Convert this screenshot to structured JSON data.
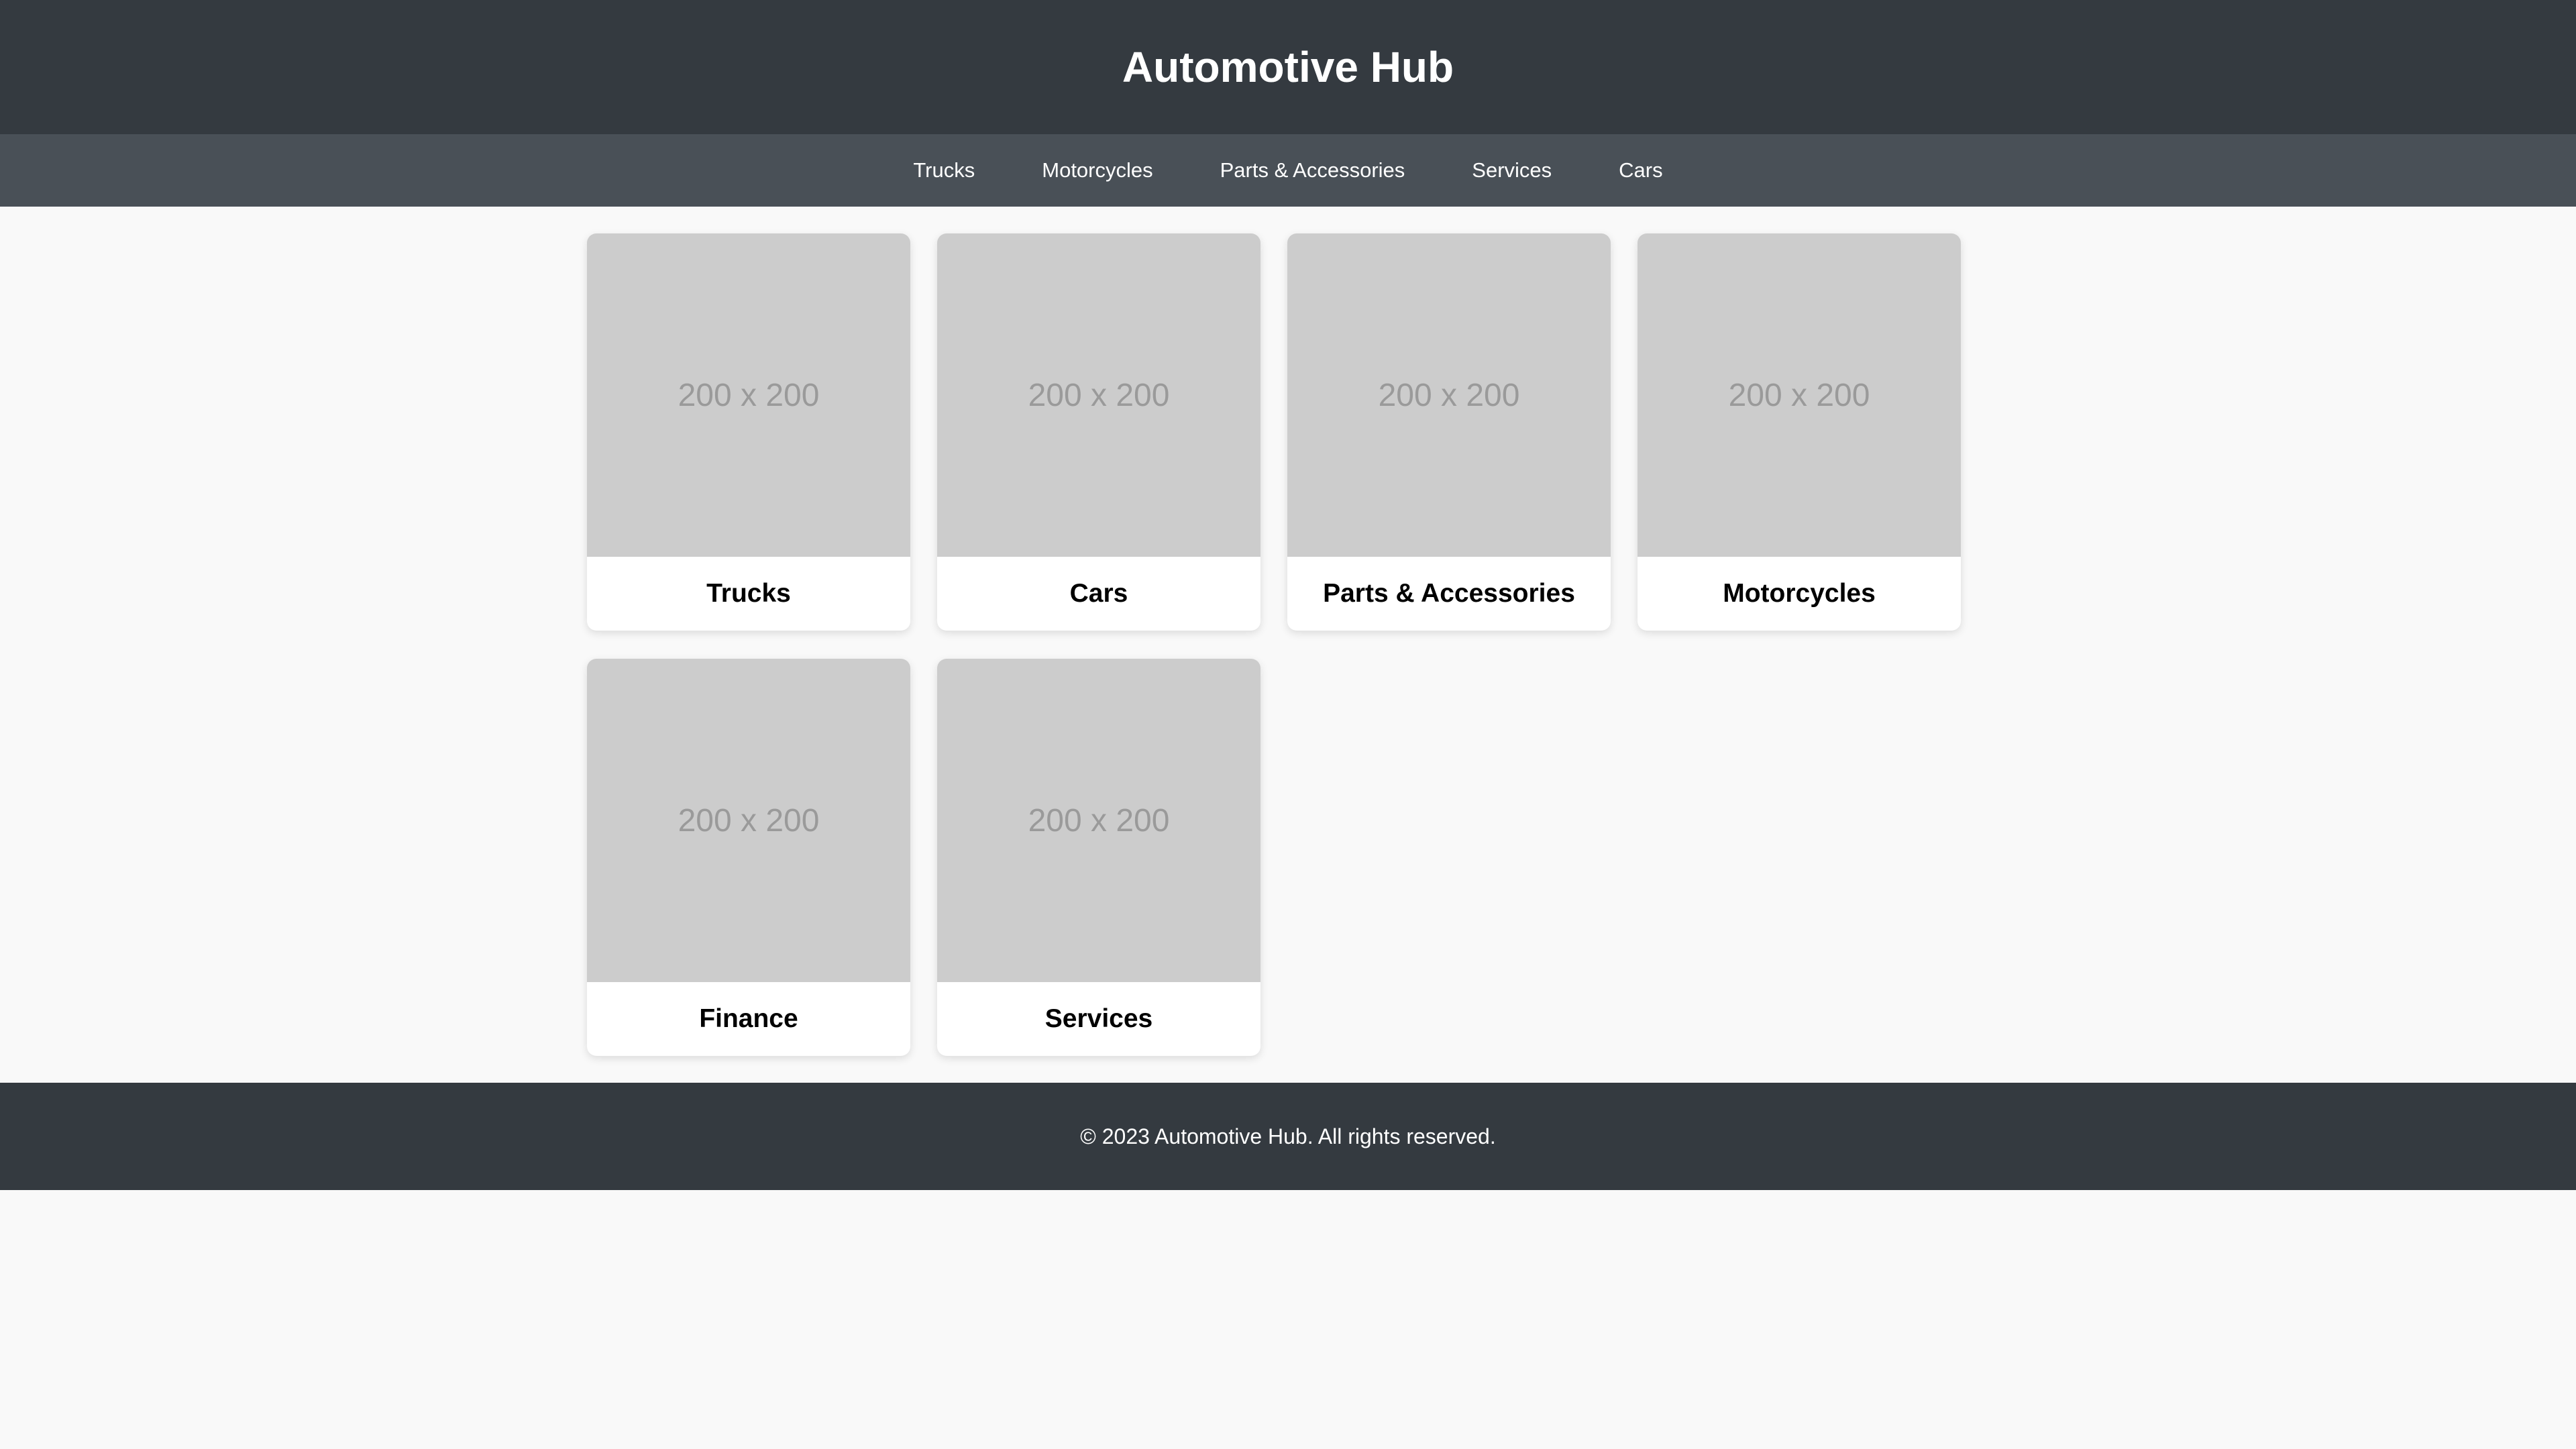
{
  "header": {
    "title": "Automotive Hub"
  },
  "nav": {
    "items": [
      {
        "label": "Trucks"
      },
      {
        "label": "Motorcycles"
      },
      {
        "label": "Parts & Accessories"
      },
      {
        "label": "Services"
      },
      {
        "label": "Cars"
      }
    ]
  },
  "cards": [
    {
      "image_label": "200 x 200",
      "title": "Trucks"
    },
    {
      "image_label": "200 x 200",
      "title": "Cars"
    },
    {
      "image_label": "200 x 200",
      "title": "Parts & Accessories"
    },
    {
      "image_label": "200 x 200",
      "title": "Motorcycles"
    },
    {
      "image_label": "200 x 200",
      "title": "Finance"
    },
    {
      "image_label": "200 x 200",
      "title": "Services"
    }
  ],
  "footer": {
    "text": "© 2023 Automotive Hub. All rights reserved."
  },
  "colors": {
    "header_bg": "#343a40",
    "nav_bg": "#495057",
    "page_bg": "#f9f9f9",
    "placeholder_bg": "#cccccc"
  }
}
